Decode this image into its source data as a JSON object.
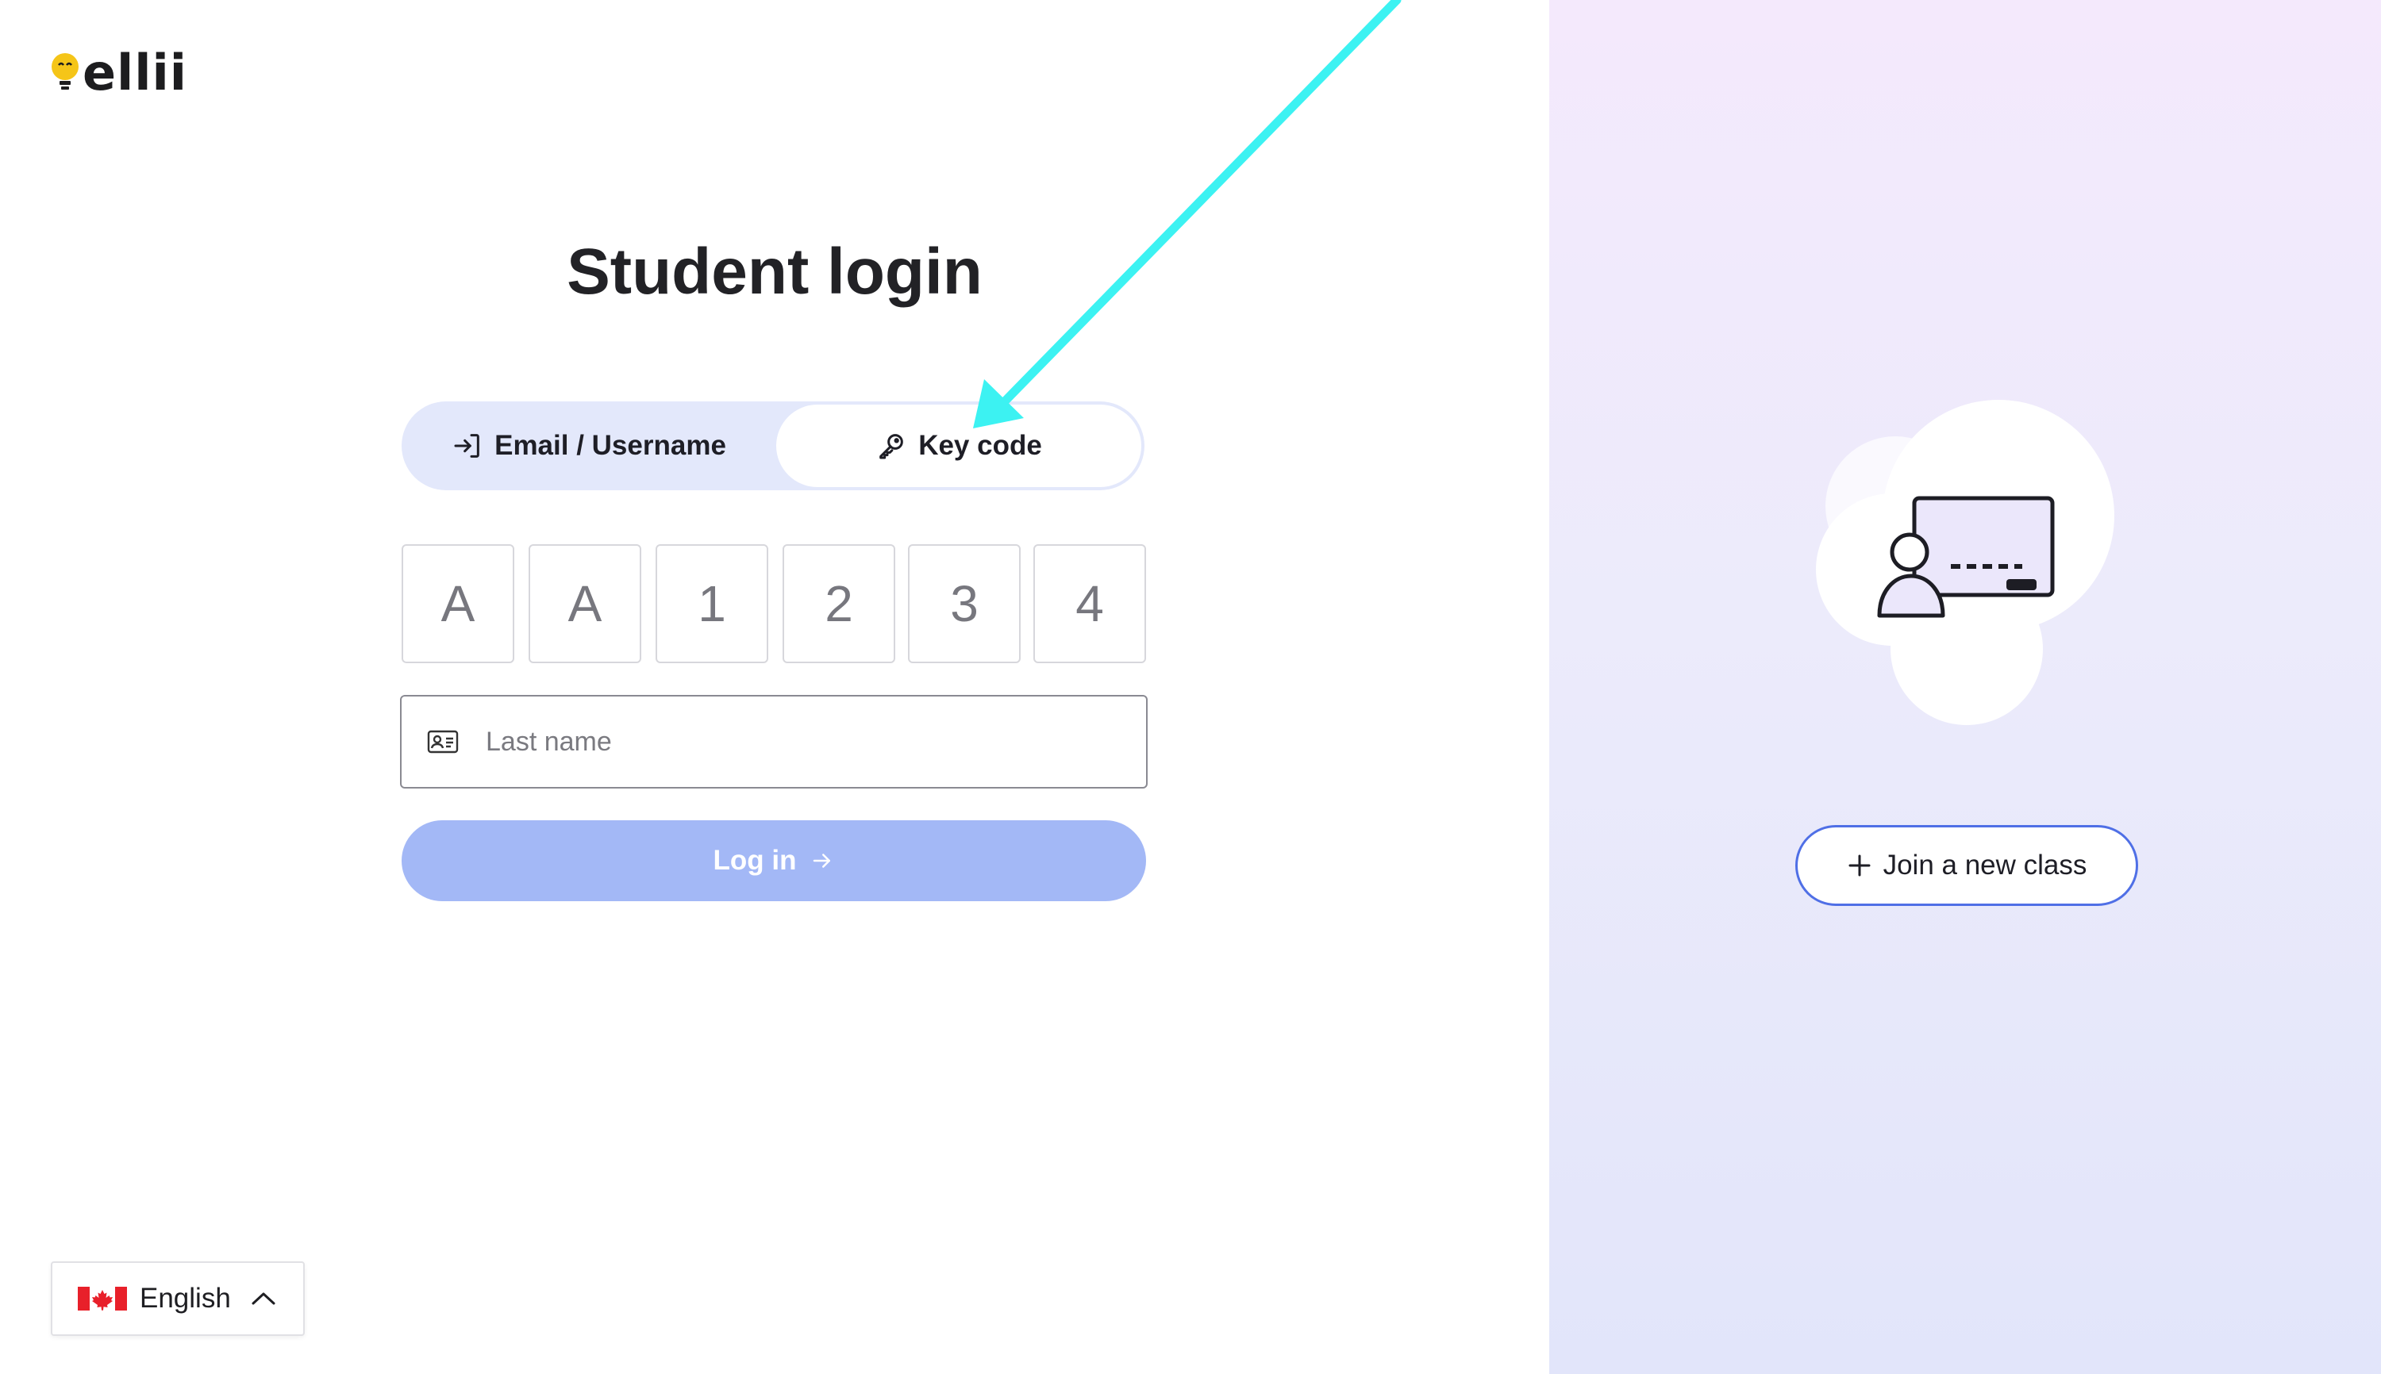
{
  "app": {
    "logo_text": "ellii"
  },
  "page": {
    "title": "Student login"
  },
  "login_tabs": [
    {
      "label": "Email / Username",
      "icon": "sign-in-icon",
      "selected": false
    },
    {
      "label": "Key code",
      "icon": "key-icon",
      "selected": true
    }
  ],
  "key_code": {
    "characters": [
      "A",
      "A",
      "1",
      "2",
      "3",
      "4"
    ]
  },
  "last_name": {
    "placeholder": "Last name",
    "value": "",
    "icon": "id-card-icon"
  },
  "login_button": {
    "label": "Log in",
    "icon": "arrow-right-icon",
    "enabled": false
  },
  "language": {
    "label": "English",
    "flag": "canada-flag-icon",
    "icon": "chevron-up-icon"
  },
  "join_class": {
    "label": "Join a new class",
    "icon": "plus-icon"
  },
  "colors": {
    "accent": "#4f6fe6",
    "login_button_disabled": "#a3b8f6",
    "tab_track": "#e3e8fb",
    "annotation_arrow": "#3cf2f2",
    "logo_bulb": "#f5c518"
  }
}
